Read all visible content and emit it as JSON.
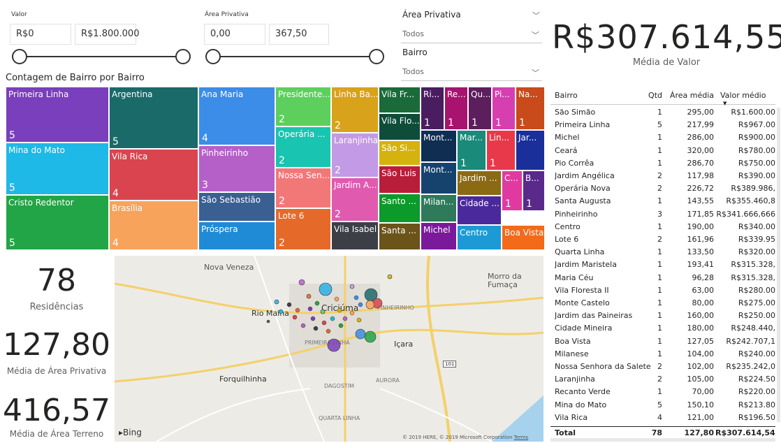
{
  "filters": {
    "valor": {
      "label": "Valor",
      "min": "R$0",
      "max": "R$1.800.000"
    },
    "area": {
      "label": "Área Privativa",
      "min": "0,00",
      "max": "367,50"
    }
  },
  "dropdowns": [
    {
      "title": "Área Privativa",
      "value": "Todos"
    },
    {
      "title": "Bairro",
      "value": "Todos"
    }
  ],
  "kpi_main": {
    "value": "R$307.614,55",
    "label": "Média de Valor"
  },
  "kpis": [
    {
      "value": "78",
      "label": "Residências"
    },
    {
      "value": "127,80",
      "label": "Média de Área Privativa"
    },
    {
      "value": "416,57",
      "label": "Média de Área Terreno"
    }
  ],
  "treemap": {
    "title": "Contagem de Bairro por Bairro",
    "tiles": [
      {
        "name": "Primeira Linha",
        "count": "5",
        "color": "#7a3fbd"
      },
      {
        "name": "Mina do Mato",
        "count": "5",
        "color": "#1eb9e6"
      },
      {
        "name": "Cristo Redentor",
        "count": "5",
        "color": "#22a546"
      },
      {
        "name": "Argentina",
        "count": "5",
        "color": "#1a6a6a"
      },
      {
        "name": "Vila Rica",
        "count": "4",
        "color": "#d9444f"
      },
      {
        "name": "Brasília",
        "count": "4",
        "color": "#f7a35c"
      },
      {
        "name": "Ana Maria",
        "count": "4",
        "color": "#3b8de8"
      },
      {
        "name": "Pinheirinho",
        "count": "3",
        "color": "#b560c9"
      },
      {
        "name": "São Sebastião",
        "count": "",
        "color": "#3a5f92"
      },
      {
        "name": "Próspera",
        "count": "",
        "color": "#1f8bd6"
      },
      {
        "name": "Presidente...",
        "count": "2",
        "color": "#5ccf5c"
      },
      {
        "name": "Operária ...",
        "count": "2",
        "color": "#19c4b0"
      },
      {
        "name": "Nossa Sen...",
        "count": "2",
        "color": "#f27878"
      },
      {
        "name": "Lote 6",
        "count": "2",
        "color": "#e56a2a"
      },
      {
        "name": "Linha Ba...",
        "count": "2",
        "color": "#d9a21b"
      },
      {
        "name": "Laranjinha",
        "count": "2",
        "color": "#c39ae6"
      },
      {
        "name": "Jardim A...",
        "count": "2",
        "color": "#e05ab0"
      },
      {
        "name": "Vila Isabel",
        "count": "",
        "color": "#3c3f46"
      },
      {
        "name": "Vila Fr...",
        "count": "",
        "color": "#1a6a3a"
      },
      {
        "name": "Vila Flo...",
        "count": "",
        "color": "#0d4d3a"
      },
      {
        "name": "São Si...",
        "count": "",
        "color": "#d6b20f"
      },
      {
        "name": "São Luis",
        "count": "",
        "color": "#b81d3a"
      },
      {
        "name": "Santo ...",
        "count": "",
        "color": "#0c9a2a"
      },
      {
        "name": "Santa ...",
        "count": "",
        "color": "#6b5419"
      },
      {
        "name": "Ri...",
        "count": "1",
        "color": "#4a1d60"
      },
      {
        "name": "Re...",
        "count": "1",
        "color": "#a8136f"
      },
      {
        "name": "Qu...",
        "count": "1",
        "color": "#5c1e5c"
      },
      {
        "name": "Pi...",
        "count": "1",
        "color": "#d63fb0"
      },
      {
        "name": "Na...",
        "count": "1",
        "color": "#c94a1a"
      },
      {
        "name": "Mont...",
        "count": "",
        "color": "#0f2e52"
      },
      {
        "name": "Mont...",
        "count": "",
        "color": "#16436e"
      },
      {
        "name": "Milan...",
        "count": "",
        "color": "#2e7a5a"
      },
      {
        "name": "Michel",
        "count": "",
        "color": "#7a1a9a"
      },
      {
        "name": "Mar...",
        "count": "1",
        "color": "#1a8a7a"
      },
      {
        "name": "Lin...",
        "count": "1",
        "color": "#e8394a"
      },
      {
        "name": "Jar...",
        "count": "",
        "color": "#1a2f9a"
      },
      {
        "name": "Jardim ...",
        "count": "",
        "color": "#8a6a12"
      },
      {
        "name": "C...",
        "count": "1",
        "color": "#e03aa0"
      },
      {
        "name": "B...",
        "count": "1",
        "color": "#5a2a8a"
      },
      {
        "name": "Cidade ...",
        "count": "",
        "color": "#4a2a9a"
      },
      {
        "name": "Centro",
        "count": "",
        "color": "#1b9ad6"
      },
      {
        "name": "Boa Vista",
        "count": "",
        "color": "#f26a1a"
      }
    ]
  },
  "map": {
    "places": [
      "Nova Veneza",
      "Morro da Fumaça",
      "Rio Maina",
      "Criciúma",
      "PINHEIRINHO",
      "Içara",
      "PRIMEIRA LINHA",
      "Forquilhinha",
      "DAGOSTIM",
      "AURORA",
      "QUARTA LINHA"
    ],
    "road_badge": "101",
    "logo": "Bing",
    "attribution": "© 2019 HERE, © 2019 Microsoft Corporation",
    "terms": "Terms",
    "bubbles": [
      {
        "color": "#2ab0e6",
        "size": 9
      },
      {
        "color": "#1a6a6a",
        "size": 9
      },
      {
        "color": "#d9444f",
        "size": 7
      },
      {
        "color": "#f7a35c",
        "size": 6
      },
      {
        "color": "#7a3fbd",
        "size": 9
      },
      {
        "color": "#22a546",
        "size": 8
      },
      {
        "color": "#3b8de8",
        "size": 7
      },
      {
        "color": "#b560c9",
        "size": 4
      },
      {
        "color": "#e56a2a",
        "size": 3
      },
      {
        "color": "#5ccf5c",
        "size": 3
      },
      {
        "color": "#3c3f46",
        "size": 2
      },
      {
        "color": "#d6b20f",
        "size": 3
      },
      {
        "color": "#1eb9e6",
        "size": 3
      },
      {
        "color": "#c39ae6",
        "size": 3
      }
    ]
  },
  "table": {
    "headers": [
      "Bairro",
      "Qtd",
      "Área média",
      "Valor médio"
    ],
    "rows": [
      [
        "São Simão",
        "1",
        "295,00",
        "R$1.600.00"
      ],
      [
        "Primeira Linha",
        "5",
        "217,99",
        "R$967.00"
      ],
      [
        "Michel",
        "1",
        "286,00",
        "R$900.00"
      ],
      [
        "Ceará",
        "1",
        "320,00",
        "R$780.00"
      ],
      [
        "Pio Corrêa",
        "1",
        "286,70",
        "R$750.00"
      ],
      [
        "Jardim Angélica",
        "2",
        "117,98",
        "R$390.00"
      ],
      [
        "Operária Nova",
        "2",
        "226,72",
        "R$389.986,"
      ],
      [
        "Santa Augusta",
        "1",
        "143,55",
        "R$355.460,8"
      ],
      [
        "Pinheirinho",
        "3",
        "171,85",
        "R$341.666,666"
      ],
      [
        "Centro",
        "1",
        "190,00",
        "R$340.00"
      ],
      [
        "Lote 6",
        "2",
        "161,96",
        "R$339.95"
      ],
      [
        "Quarta Linha",
        "1",
        "133,50",
        "R$320.00"
      ],
      [
        "Jardim Maristela",
        "1",
        "193,41",
        "R$315.328,"
      ],
      [
        "Maria Céu",
        "1",
        "96,28",
        "R$315.328,"
      ],
      [
        "Vila Floresta II",
        "1",
        "63,00",
        "R$280.00"
      ],
      [
        "Monte Castelo",
        "1",
        "80,00",
        "R$275.00"
      ],
      [
        "Jardim das Paineiras",
        "1",
        "160,00",
        "R$250.00"
      ],
      [
        "Cidade Mineira",
        "1",
        "180,00",
        "R$248.440,"
      ],
      [
        "Boa Vista",
        "1",
        "127,05",
        "R$242.707,1"
      ],
      [
        "Milanese",
        "1",
        "104,00",
        "R$240.00"
      ],
      [
        "Nossa Senhora da Salete",
        "2",
        "102,00",
        "R$235.242,0"
      ],
      [
        "Laranjinha",
        "2",
        "105,00",
        "R$224.50"
      ],
      [
        "Recanto Verde",
        "1",
        "70,00",
        "R$220.00"
      ],
      [
        "Mina do Mato",
        "5",
        "150,10",
        "R$213.80"
      ],
      [
        "Vila Rica",
        "4",
        "121,00",
        "R$196.50"
      ]
    ],
    "total": [
      "Total",
      "78",
      "127,80",
      "R$307.614,545"
    ]
  }
}
